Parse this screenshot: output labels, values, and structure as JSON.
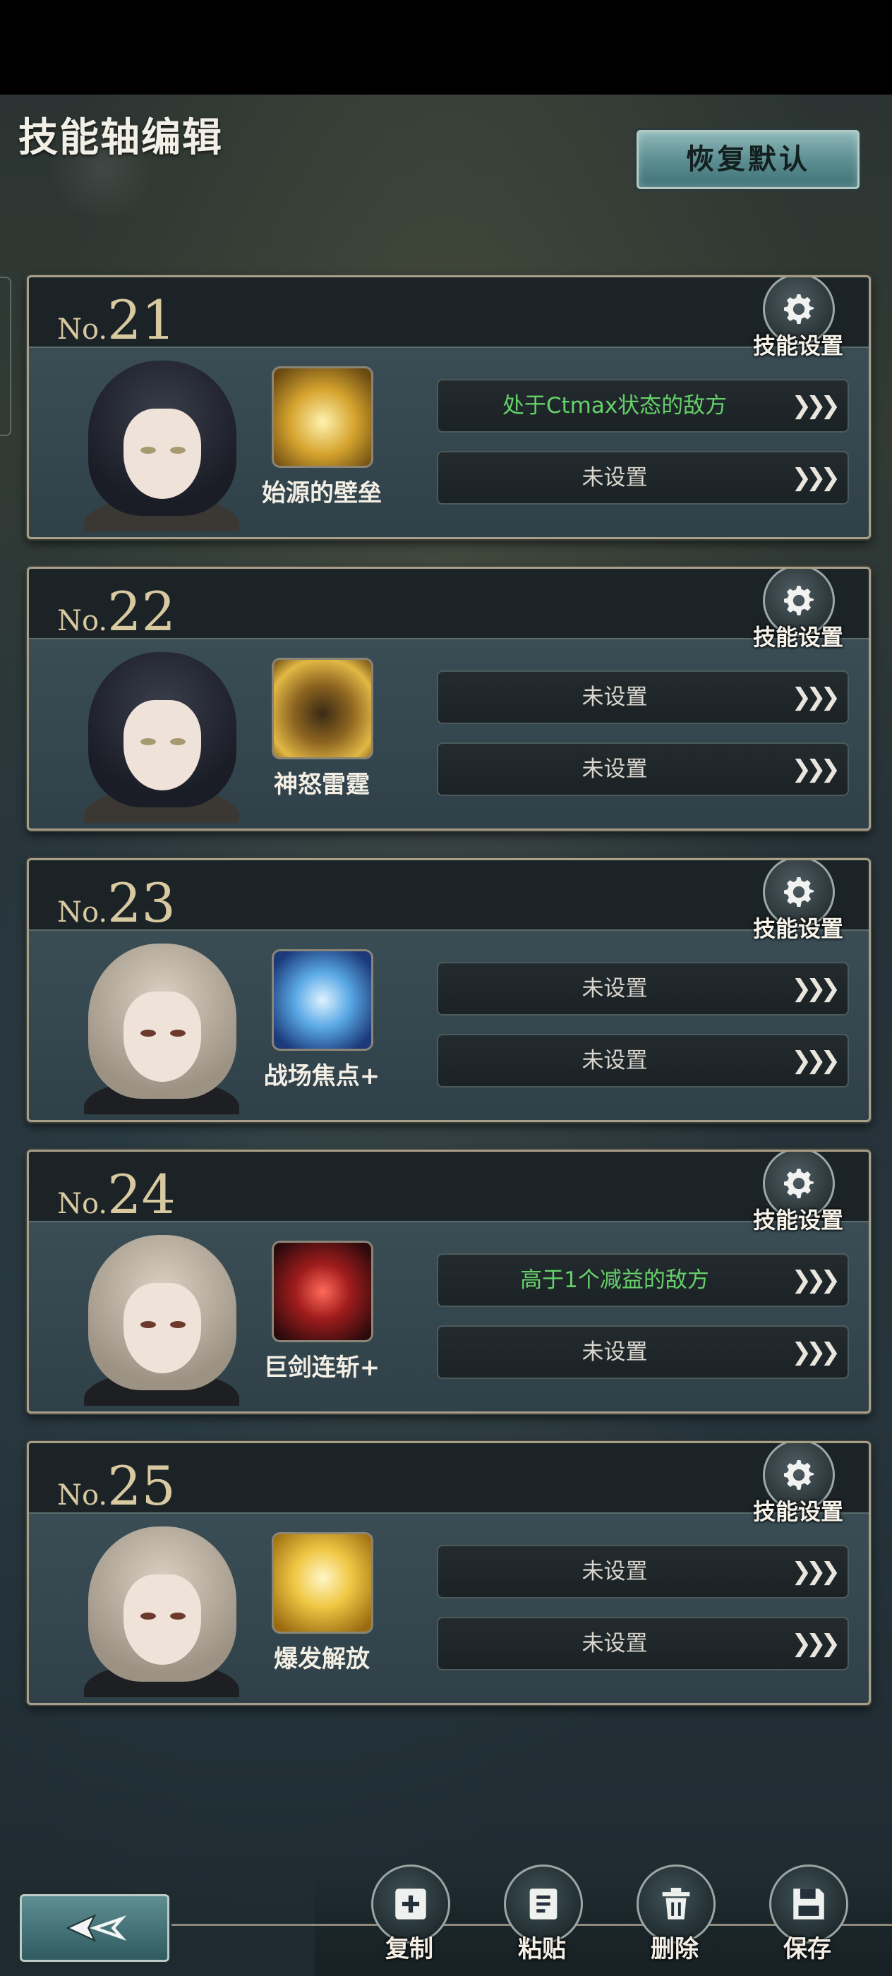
{
  "header": {
    "title": "技能轴编辑",
    "restore_label": "恢复默认"
  },
  "cards": [
    {
      "no_prefix": "No.",
      "number": "21",
      "gear_label": "技能设置",
      "character": "dark",
      "skill_name": "始源的壁垒",
      "skill_icon": "golden-barrier-icon",
      "conditions": [
        {
          "text": "处于Ctmax状态的敌方",
          "color": "#66d06a"
        },
        {
          "text": "未设置",
          "color": "#d9d6cd"
        }
      ]
    },
    {
      "no_prefix": "No.",
      "number": "22",
      "gear_label": "技能设置",
      "character": "dark",
      "skill_name": "神怒雷霆",
      "skill_icon": "thunder-rock-icon",
      "conditions": [
        {
          "text": "未设置",
          "color": "#d9d6cd"
        },
        {
          "text": "未设置",
          "color": "#d9d6cd"
        }
      ]
    },
    {
      "no_prefix": "No.",
      "number": "23",
      "gear_label": "技能设置",
      "character": "light",
      "skill_name": "战场焦点+",
      "skill_icon": "ice-shield-icon",
      "conditions": [
        {
          "text": "未设置",
          "color": "#d9d6cd"
        },
        {
          "text": "未设置",
          "color": "#d9d6cd"
        }
      ]
    },
    {
      "no_prefix": "No.",
      "number": "24",
      "gear_label": "技能设置",
      "character": "light",
      "skill_name": "巨剑连斩+",
      "skill_icon": "crimson-sword-icon",
      "conditions": [
        {
          "text": "高于1个减益的敌方",
          "color": "#66d06a"
        },
        {
          "text": "未设置",
          "color": "#d9d6cd"
        }
      ]
    },
    {
      "no_prefix": "No.",
      "number": "25",
      "gear_label": "技能设置",
      "character": "light",
      "skill_name": "爆发解放",
      "skill_icon": "golden-burst-icon",
      "conditions": [
        {
          "text": "未设置",
          "color": "#d9d6cd"
        },
        {
          "text": "未设置",
          "color": "#d9d6cd"
        }
      ]
    }
  ],
  "actions": {
    "copy": "复制",
    "paste": "粘贴",
    "delete": "删除",
    "save": "保存"
  },
  "arrow_glyph": "❯❯❯",
  "colors": {
    "accent_green": "#66d06a",
    "gold": "#d8c9a0",
    "teal_button": "#5d8f93"
  }
}
